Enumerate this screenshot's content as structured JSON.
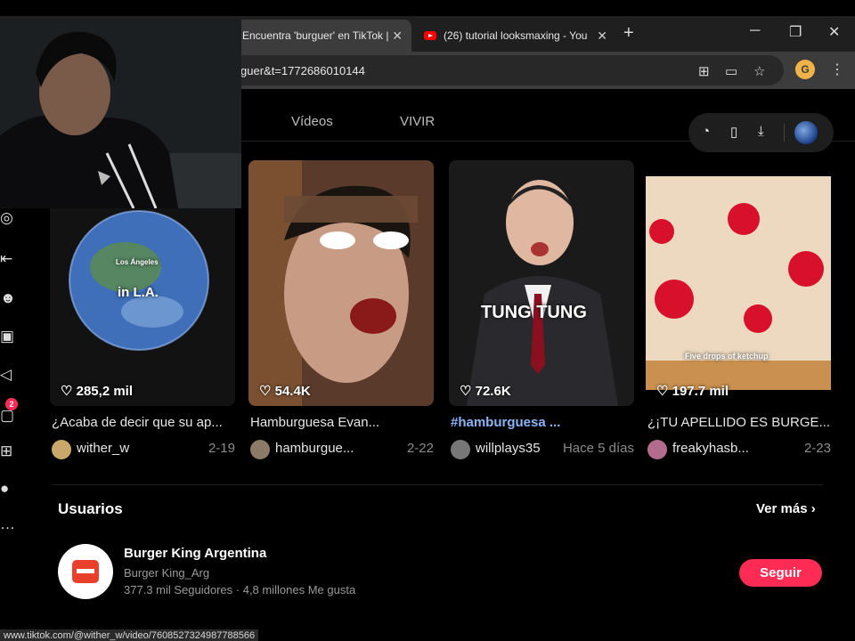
{
  "browser": {
    "tabs": [
      {
        "title": "Encuentra 'burguer' en TikTok |",
        "active": true
      },
      {
        "title": "(26) tutorial looksmaxing - You",
        "active": false
      }
    ],
    "url": "guer&t=1772686010144",
    "extension_letter": "G"
  },
  "page": {
    "tabs": [
      "Vídeos",
      "VIVIR"
    ],
    "sidebar_badge": "2",
    "videos": [
      {
        "likes": "285,2 mil",
        "caption": "¿Acaba de decir que su ap...",
        "author": "wither_w",
        "date": "2-19",
        "overlay": "in L.A.",
        "overlay_small": "Los Ángeles"
      },
      {
        "likes": "54.4K",
        "caption": "Hamburguesa Evan...",
        "author": "hamburgue...",
        "date": "2-22"
      },
      {
        "likes": "72.6K",
        "caption": "#hamburguesa ...",
        "author": "willplays35",
        "date": "Hace 5 días",
        "overlay": "TUNG TUNG"
      },
      {
        "likes": "197.7 mil",
        "caption": "¿¡TU APELLIDO ES BURGE...",
        "author": "freakyhasb...",
        "date": "2-23",
        "overlay": "Five drops of ketchup"
      }
    ],
    "users_section": {
      "title": "Usuarios",
      "see_more": "Ver más",
      "user": {
        "name": "Burger King Argentina",
        "handle": "Burger King_Arg",
        "followers": "377.3 mil Seguidores",
        "likes": "4,8 millones Me gusta",
        "follow_label": "Seguir"
      }
    }
  },
  "status_url": "www.tiktok.com/@wither_w/video/7608527324987788566",
  "colors": {
    "accent": "#fe2c55",
    "hashtag": "#8ab4f8"
  }
}
